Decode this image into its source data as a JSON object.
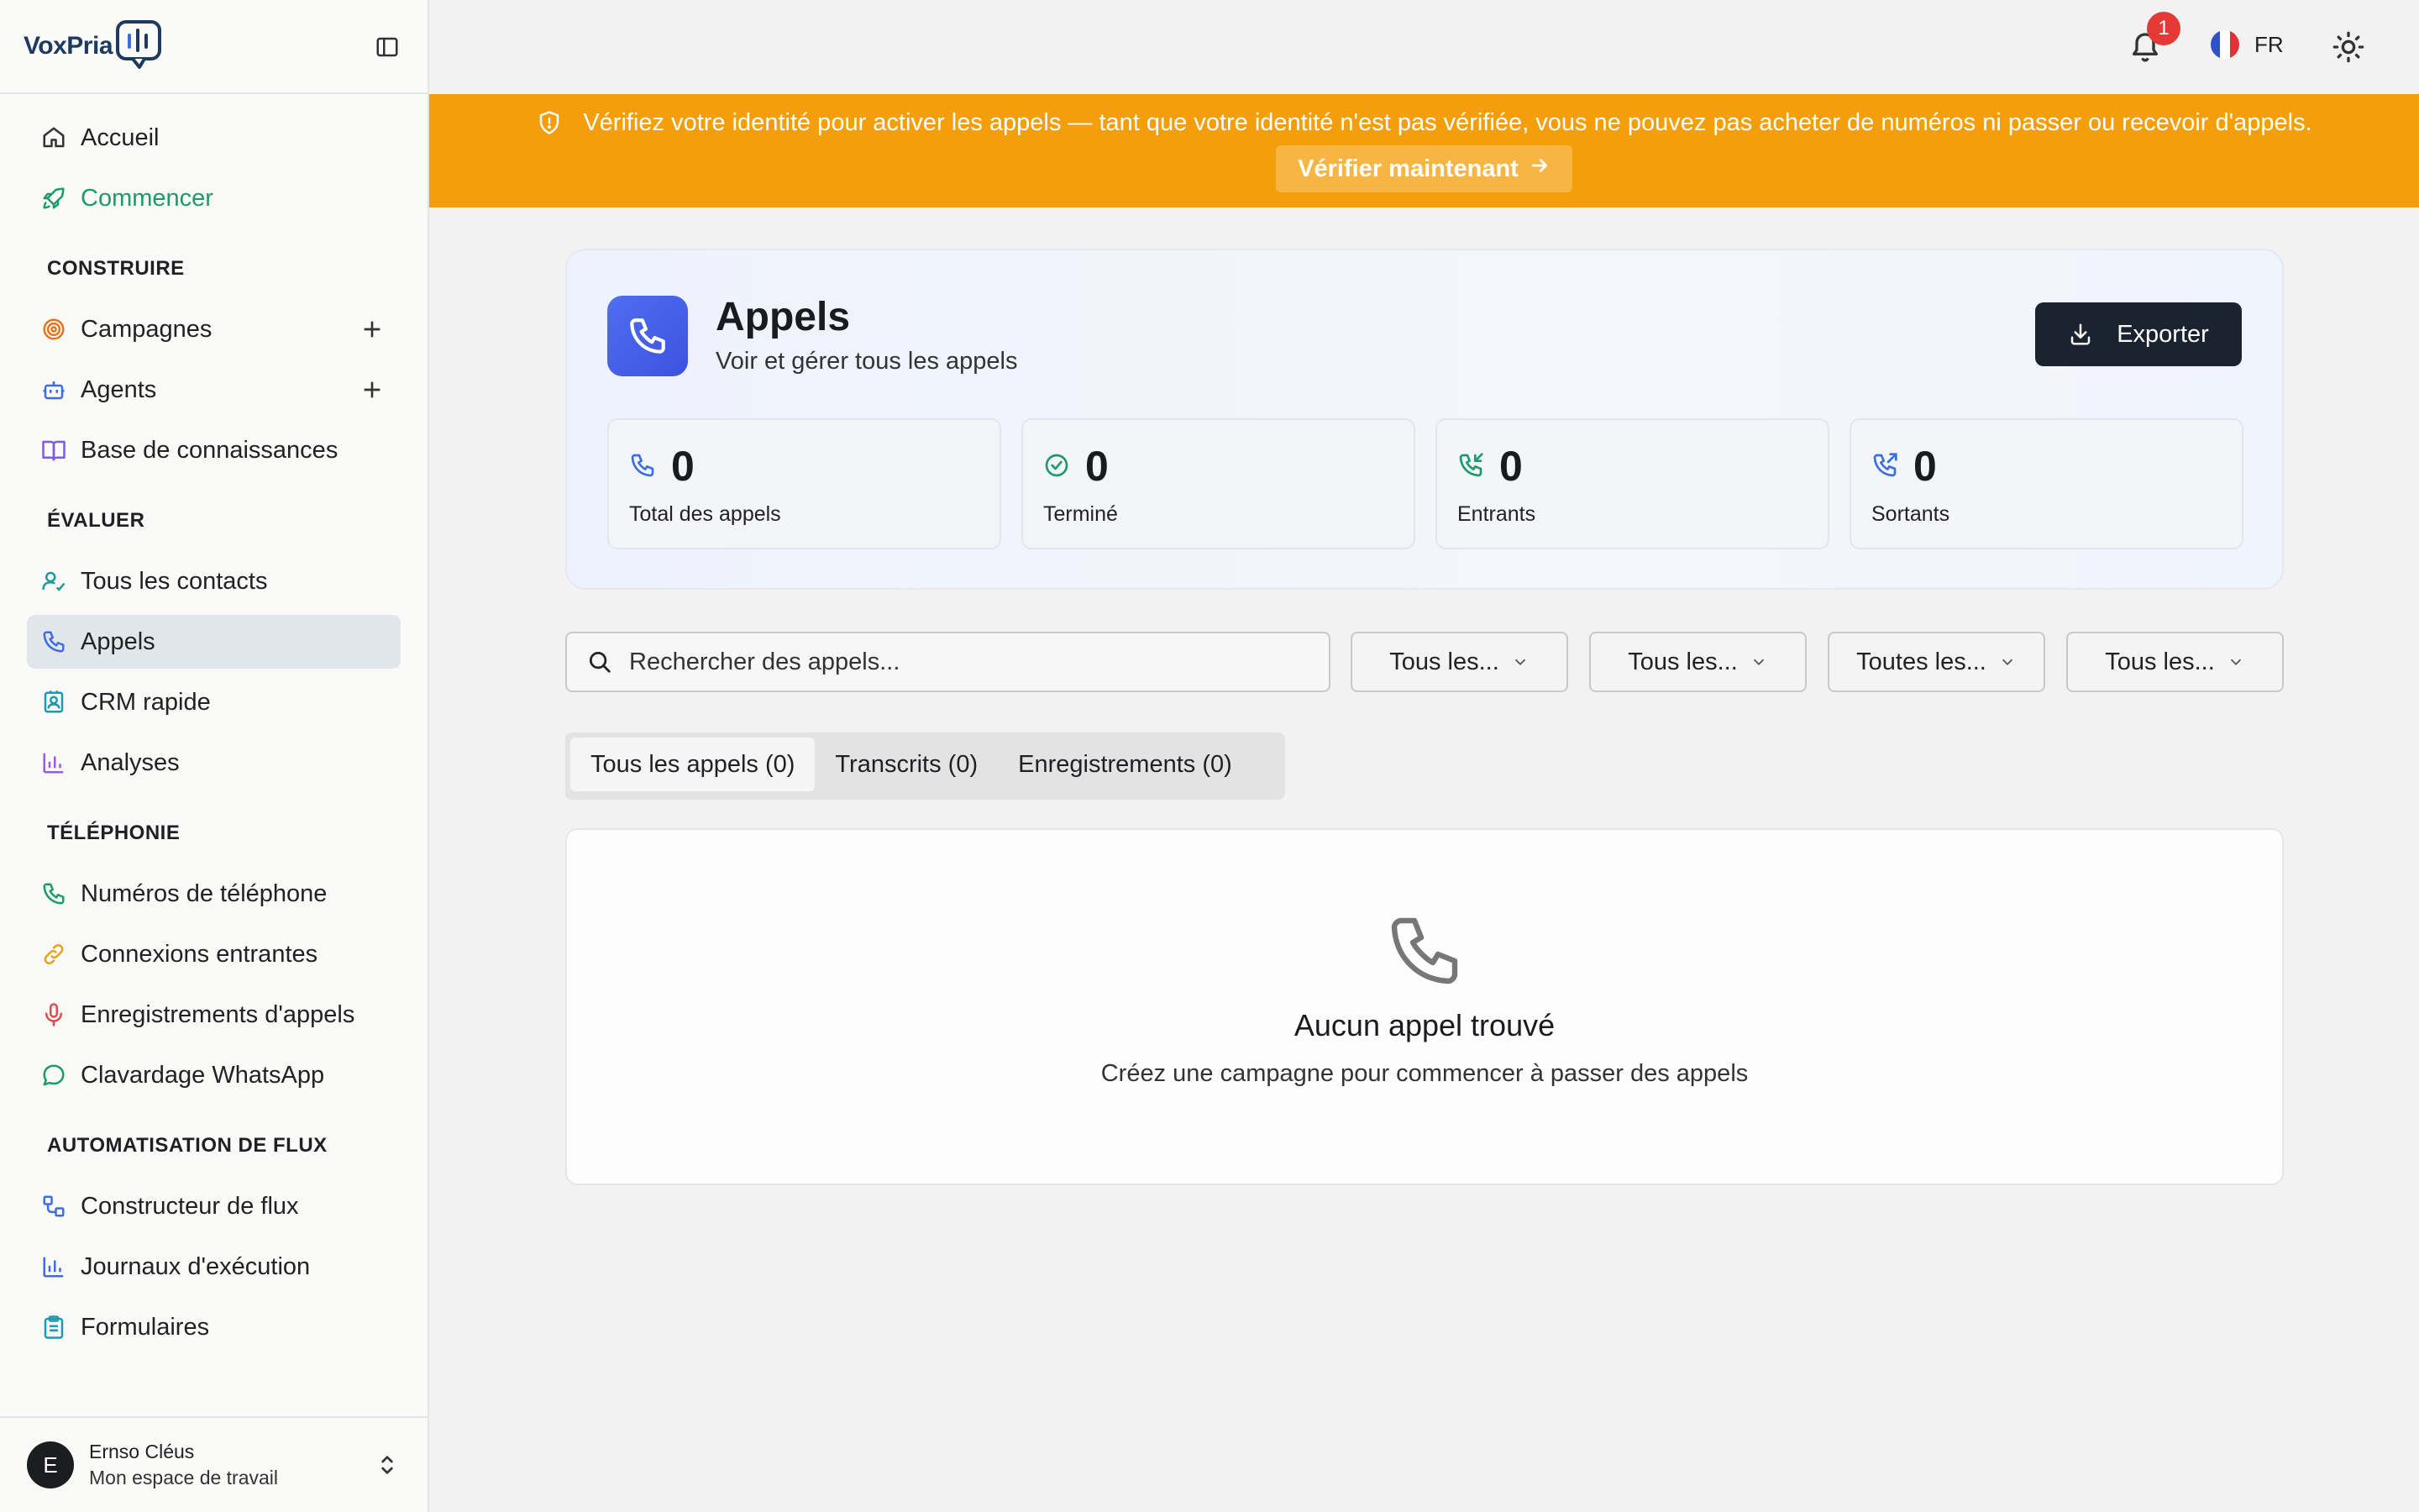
{
  "app": {
    "logo_text": "VoxPria"
  },
  "colors": {
    "accent_green": "#1c9a6c",
    "banner": "#f59e0b",
    "primary_blue": "#4f6ef0",
    "dark_button": "#1c2330"
  },
  "sidebar": {
    "top_items": [
      {
        "label": "Accueil",
        "icon": "home-icon"
      },
      {
        "label": "Commencer",
        "icon": "rocket-icon"
      }
    ],
    "sections": {
      "construire": "CONSTRUIRE",
      "evaluer": "ÉVALUER",
      "telephonie": "TÉLÉPHONIE",
      "automatisation": "AUTOMATISATION DE FLUX"
    },
    "construire_items": [
      {
        "label": "Campagnes",
        "icon": "target-icon"
      },
      {
        "label": "Agents",
        "icon": "bot-icon"
      },
      {
        "label": "Base de connaissances",
        "icon": "book-icon"
      }
    ],
    "evaluer_items": [
      {
        "label": "Tous les contacts",
        "icon": "users-icon"
      },
      {
        "label": "Appels",
        "icon": "phone-icon"
      },
      {
        "label": "CRM rapide",
        "icon": "contact-card-icon"
      },
      {
        "label": "Analyses",
        "icon": "bar-chart-icon"
      }
    ],
    "telephonie_items": [
      {
        "label": "Numéros de téléphone",
        "icon": "phone-icon"
      },
      {
        "label": "Connexions entrantes",
        "icon": "link-icon"
      },
      {
        "label": "Enregistrements d'appels",
        "icon": "mic-icon"
      },
      {
        "label": "Clavardage WhatsApp",
        "icon": "chat-icon"
      }
    ],
    "automatisation_items": [
      {
        "label": "Constructeur de flux",
        "icon": "workflow-icon"
      },
      {
        "label": "Journaux d'exécution",
        "icon": "bar-chart-icon"
      },
      {
        "label": "Formulaires",
        "icon": "clipboard-icon"
      }
    ],
    "user": {
      "initial": "E",
      "name": "Ernso Cléus",
      "workspace": "Mon espace de travail"
    }
  },
  "topbar": {
    "notifications_count": "1",
    "language": "FR"
  },
  "banner": {
    "message": "Vérifiez votre identité pour activer les appels — tant que votre identité n'est pas vérifiée, vous ne pouvez pas acheter de numéros ni passer ou recevoir d'appels.",
    "button": "Vérifier maintenant"
  },
  "page": {
    "title": "Appels",
    "subtitle": "Voir et gérer tous les appels",
    "export_label": "Exporter",
    "stats": [
      {
        "value": "0",
        "label": "Total des appels",
        "icon": "phone-icon"
      },
      {
        "value": "0",
        "label": "Terminé",
        "icon": "check-circle-icon"
      },
      {
        "value": "0",
        "label": "Entrants",
        "icon": "phone-incoming-icon"
      },
      {
        "value": "0",
        "label": "Sortants",
        "icon": "phone-outgoing-icon"
      }
    ],
    "search_placeholder": "Rechercher des appels...",
    "filters": [
      "Tous les...",
      "Tous les...",
      "Toutes les...",
      "Tous les..."
    ],
    "tabs": [
      "Tous les appels (0)",
      "Transcrits (0)",
      "Enregistrements (0)"
    ],
    "empty": {
      "title": "Aucun appel trouvé",
      "subtitle": "Créez une campagne pour commencer à passer des appels"
    }
  }
}
